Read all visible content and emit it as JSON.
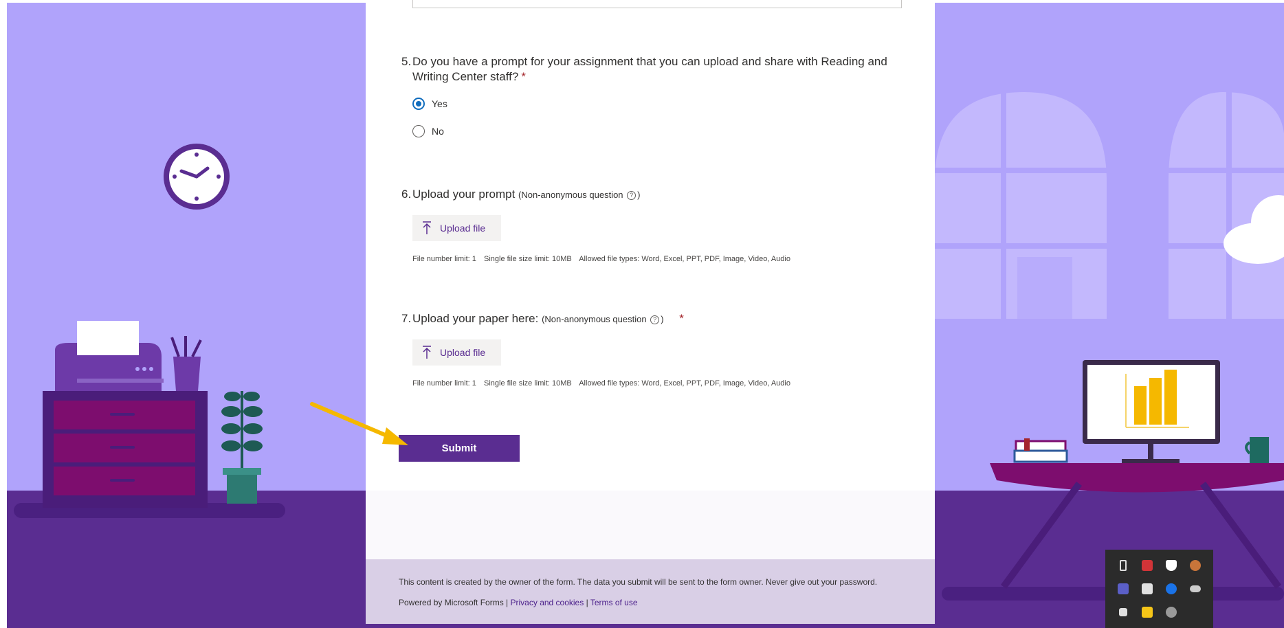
{
  "colors": {
    "accent": "#5a2d91",
    "background": "#b0a3fb",
    "floor": "#5a2d91",
    "radio_selected": "#0f6cbd",
    "required": "#a4262c",
    "arrow": "#f5b800"
  },
  "questions": [
    {
      "number": "5.",
      "title": "Do you have a prompt for your assignment that you can upload and share with Reading and Writing Center staff?",
      "required_mark": "*",
      "options": [
        {
          "label": "Yes",
          "selected": true
        },
        {
          "label": "No",
          "selected": false
        }
      ]
    },
    {
      "number": "6.",
      "title": "Upload your prompt",
      "sub_open": "(Non-anonymous question",
      "sub_close": ")",
      "help_glyph": "?",
      "upload_label": "Upload file",
      "limits": [
        "File number limit: 1",
        "Single file size limit: 10MB",
        "Allowed file types: Word, Excel, PPT, PDF, Image, Video, Audio"
      ]
    },
    {
      "number": "7.",
      "title": "Upload your paper here:",
      "sub_open": "(Non-anonymous question",
      "sub_close": ")",
      "help_glyph": "?",
      "required_mark": "*",
      "upload_label": "Upload file",
      "limits": [
        "File number limit: 1",
        "Single file size limit: 10MB",
        "Allowed file types: Word, Excel, PPT, PDF, Image, Video, Audio"
      ]
    }
  ],
  "submit": {
    "label": "Submit"
  },
  "footer": {
    "disclaimer": "This content is created by the owner of the form. The data you submit will be sent to the form owner. Never give out your password.",
    "powered_by": "Powered by Microsoft Forms |",
    "privacy_link": "Privacy and cookies",
    "separator": "|",
    "terms_link": "Terms of use"
  },
  "tray_icons": [
    "usb-drive-icon",
    "antivirus-icon",
    "shield-icon",
    "mic-icon",
    "teams-icon",
    "printer-icon",
    "bluetooth-icon",
    "cloud-sync-icon",
    "slack-icon",
    "sticky-notes-icon",
    "skype-icon"
  ]
}
